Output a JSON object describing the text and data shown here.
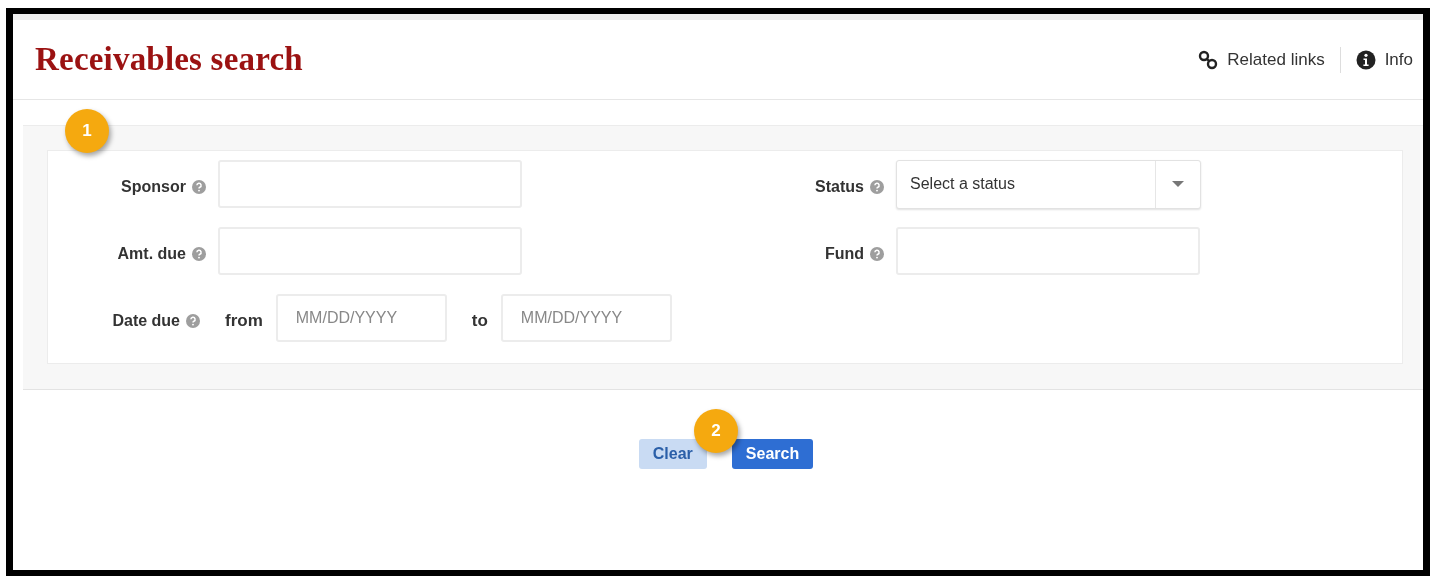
{
  "header": {
    "title": "Receivables search",
    "links": [
      {
        "kind": "related",
        "label": "Related links"
      },
      {
        "kind": "info",
        "label": "Info"
      }
    ]
  },
  "form": {
    "callout": "1",
    "rows": [
      {
        "left": {
          "kind": "text",
          "label": "Sponsor"
        },
        "right": {
          "kind": "select",
          "label": "Status",
          "placeholder": "Select a status"
        }
      },
      {
        "left": {
          "kind": "text",
          "label": "Amt. due"
        },
        "right": {
          "kind": "text",
          "label": "Fund"
        }
      },
      {
        "left": {
          "kind": "daterange",
          "label": "Date due",
          "from_label": "from",
          "from_placeholder": "MM/DD/YYYY",
          "to_label": "to",
          "to_placeholder": "MM/DD/YYYY"
        }
      }
    ]
  },
  "button_bar": {
    "callout": "2",
    "buttons": [
      {
        "kind": "secondary",
        "label": "Clear"
      },
      {
        "kind": "primary",
        "label": "Search"
      }
    ]
  }
}
